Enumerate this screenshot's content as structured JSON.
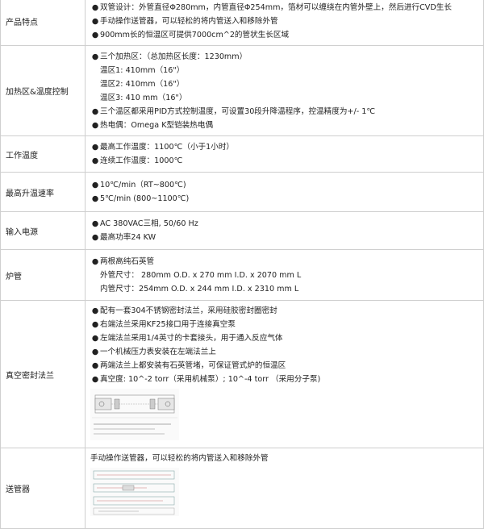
{
  "rows": [
    {
      "label": "产品特点",
      "lines": [
        "双管设计：外管直径Φ280mm，内管直径Φ254mm，箔材可以缠绕在内管外壁上，然后进行CVD生长",
        "手动操作送管器，可以轻松的将内管送入和移除外管",
        "900mm长的恒温区可提供7000cm^2的管状生长区域"
      ]
    },
    {
      "label": "加热区&温度控制",
      "lines": [
        "三个加热区：（总加热区长度：1230mm）",
        "温区1: 410mm（16\"）",
        "温区2: 410mm（16\"）",
        "温区3: 410 mm（16\"）",
        "三个温区都采用PID方式控制温度，可设置30段升降温程序，控温精度为+/- 1℃",
        "热电偶：Omega K型铠装热电偶"
      ]
    },
    {
      "label": "工作温度",
      "lines": [
        "最高工作温度：1100℃（小于1小时）",
        "连续工作温度：1000℃"
      ]
    },
    {
      "label": "最高升温速率",
      "lines": [
        "10℃/min（RT~800℃)",
        "5℃/min (800~1100℃)"
      ]
    },
    {
      "label": "输入电源",
      "lines": [
        "AC 380VAC三相, 50/60 Hz",
        "最高功率24 KW"
      ]
    },
    {
      "label": "炉管",
      "lines": [
        "两根高纯石英管",
        "外管尺寸：  280mm O.D. x 270 mm I.D. x 2070 mm L",
        "内管尺寸：254mm O.D. x  244 mm I.D. x 2310 mm L"
      ]
    },
    {
      "label": "真空密封法兰",
      "lines": [
        "配有一套304不锈钢密封法兰，采用硅胶密封圈密封",
        "右端法兰采用KF25接口用于连接真空泵",
        "左端法兰采用1/4英寸的卡套接头，用于通入反应气体",
        "一个机械压力表安装在左端法兰上",
        "两端法兰上都安装有石英管堵，可保证管式炉的恒温区",
        "真空度: 10^-2 torr（采用机械泵）; 10^-4 torr （采用分子泵)"
      ]
    },
    {
      "label": "送管器",
      "lines": [
        "手动操作送管器，可以轻松的将内管送入和移除外管"
      ]
    }
  ]
}
